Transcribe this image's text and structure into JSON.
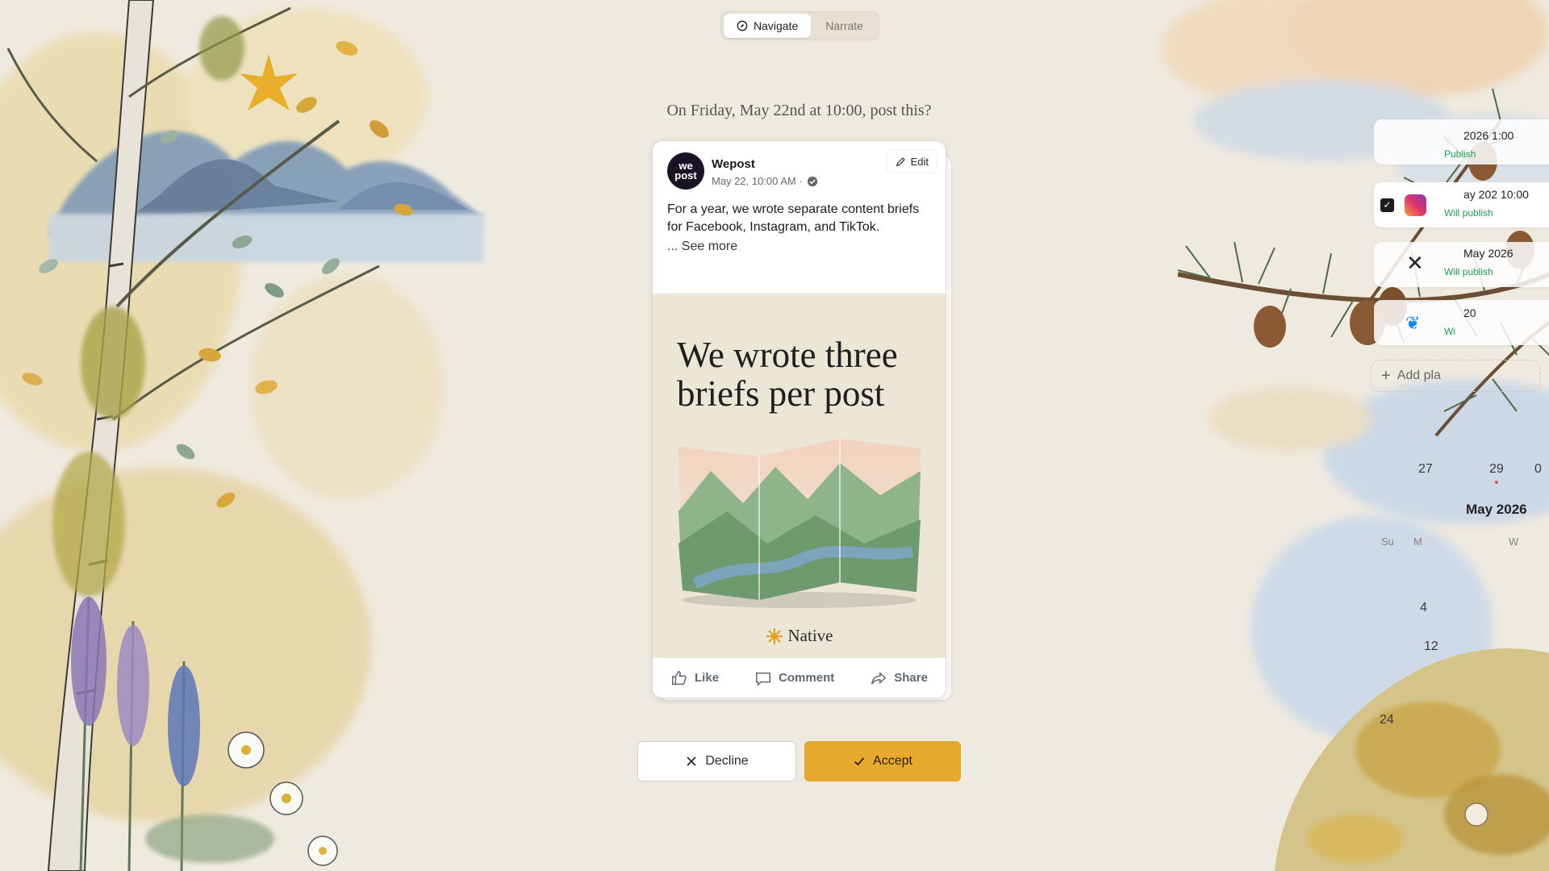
{
  "toggle": {
    "navigate_label": "Navigate",
    "narrate_label": "Narrate",
    "active": "Navigate"
  },
  "prompt": "On Friday, May 22nd at 10:00, post this?",
  "post": {
    "avatar_text_top": "we",
    "avatar_text_bottom": "post",
    "author": "Wepost",
    "meta": "May 22, 10:00 AM ·",
    "edit_label": "Edit",
    "text": "For a year, we wrote separate content briefs for Facebook, Instagram, and TikTok.",
    "see_more": "... See more",
    "creative_headline": "We wrote three briefs per post",
    "brand": "Native",
    "actions": {
      "like": "Like",
      "comment": "Comment",
      "share": "Share"
    }
  },
  "decision": {
    "decline_label": "Decline",
    "accept_label": "Accept"
  },
  "colors": {
    "accent": "#e8aa2e",
    "background": "#eeeadf",
    "status_green": "#1f9d55"
  },
  "side_panel": {
    "rows": [
      {
        "time": "2026 1:00",
        "status": "Publish"
      },
      {
        "time": "ay 202  10:00",
        "status": "Will publish"
      },
      {
        "time": "May 2026",
        "status": "Will publish"
      },
      {
        "time": "20",
        "status": "Wi"
      }
    ],
    "add_platform": "Add pla",
    "calendar": {
      "title": "May 2026",
      "top_numbers": [
        "27",
        "29",
        "0"
      ],
      "dow": [
        "Su",
        "M",
        "W"
      ],
      "numbers": [
        "4",
        "12",
        "24"
      ]
    }
  }
}
